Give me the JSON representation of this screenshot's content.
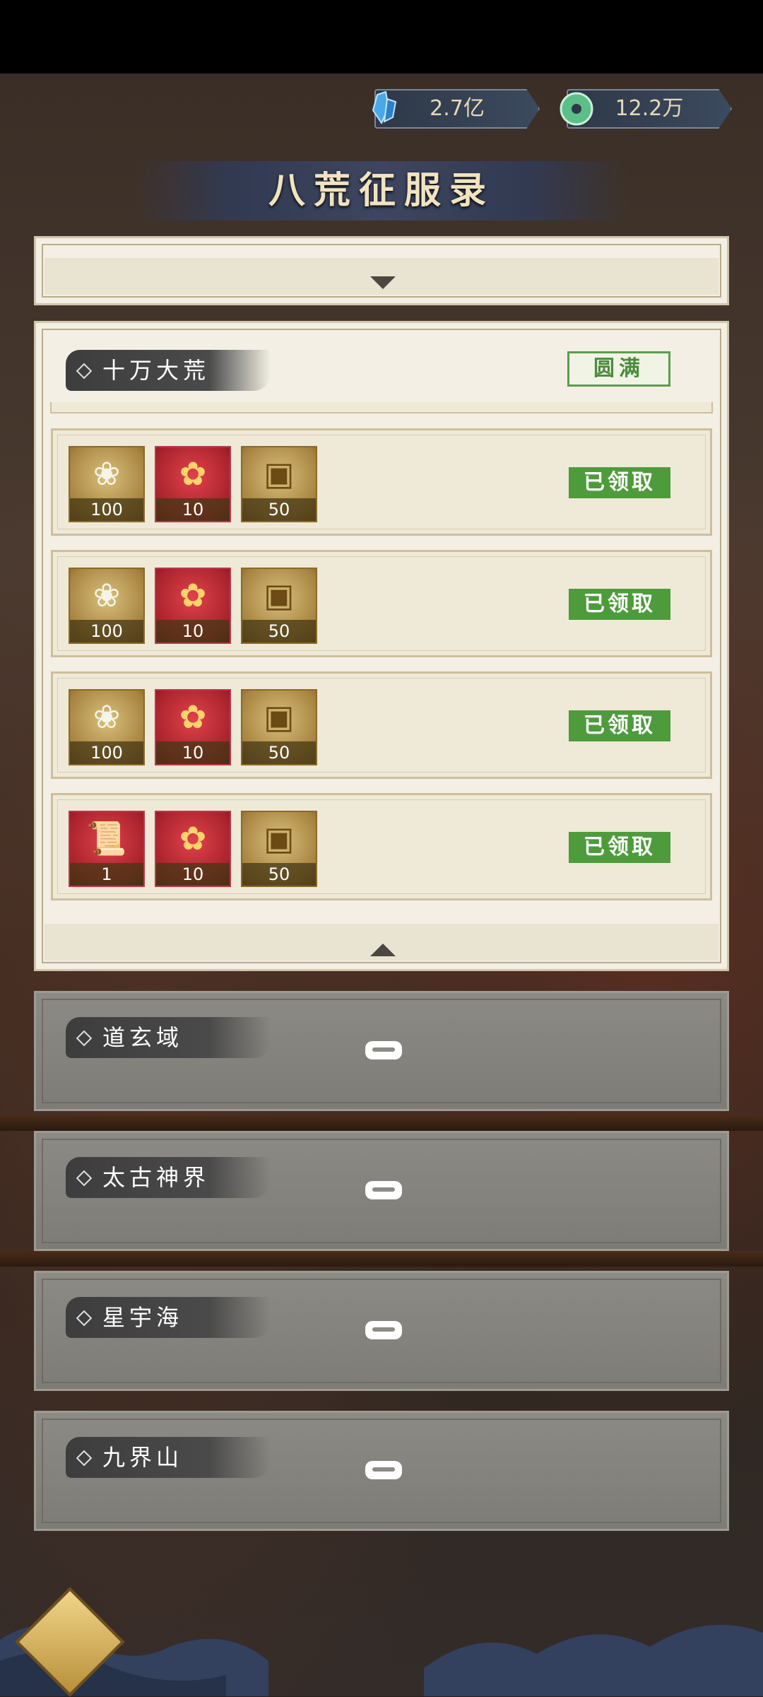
{
  "currency": {
    "crystal": {
      "icon": "blue-crystal-icon",
      "amount": "2.7亿"
    },
    "jade": {
      "icon": "jade-coin-icon",
      "amount": "12.2万"
    }
  },
  "title": "八荒征服录",
  "sections": {
    "active": {
      "name": "十万大荒",
      "status": "圆满",
      "rewards": [
        {
          "items": [
            {
              "icon": "spirit-flame-icon",
              "qty": "100"
            },
            {
              "icon": "red-gift-bag-icon",
              "qty": "10"
            },
            {
              "icon": "treasure-chest-icon",
              "qty": "50"
            }
          ],
          "button": "已领取"
        },
        {
          "items": [
            {
              "icon": "spirit-flame-icon",
              "qty": "100"
            },
            {
              "icon": "red-gift-bag-icon",
              "qty": "10"
            },
            {
              "icon": "treasure-chest-icon",
              "qty": "50"
            }
          ],
          "button": "已领取"
        },
        {
          "items": [
            {
              "icon": "spirit-flame-icon",
              "qty": "100"
            },
            {
              "icon": "red-gift-bag-icon",
              "qty": "10"
            },
            {
              "icon": "treasure-chest-icon",
              "qty": "50"
            }
          ],
          "button": "已领取"
        },
        {
          "items": [
            {
              "icon": "scroll-icon",
              "qty": "1"
            },
            {
              "icon": "red-gift-bag-icon",
              "qty": "10"
            },
            {
              "icon": "treasure-chest-icon",
              "qty": "50"
            }
          ],
          "button": "已领取"
        }
      ]
    },
    "locked": [
      {
        "name": "道玄域"
      },
      {
        "name": "太古神界"
      },
      {
        "name": "星宇海"
      },
      {
        "name": "九界山"
      }
    ]
  },
  "colors": {
    "claimed_green": "#4e9b3c",
    "panel_cream": "#f3efe4",
    "locked_grey": "#8c8a84"
  }
}
